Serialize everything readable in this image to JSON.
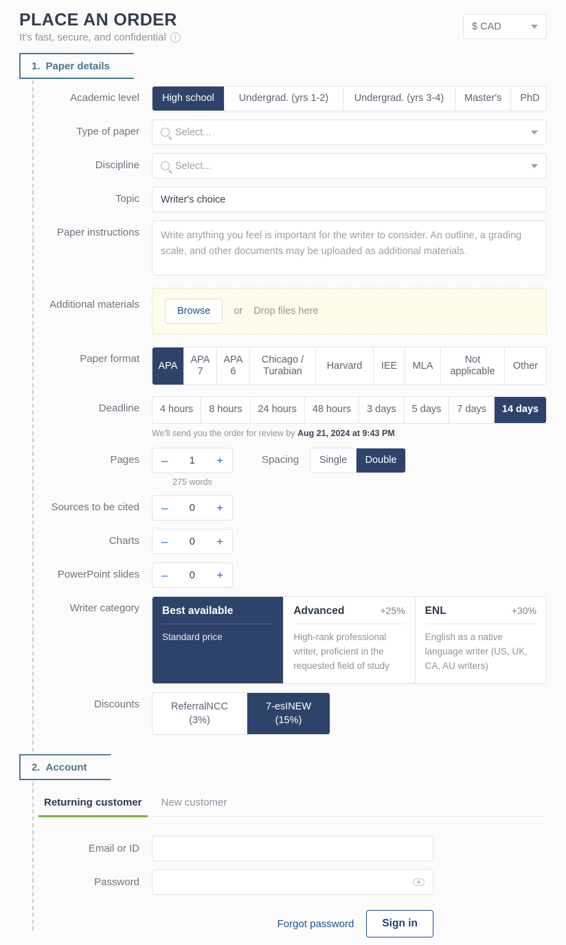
{
  "header": {
    "title": "PLACE AN ORDER",
    "subtitle": "It's fast, secure, and confidential",
    "info_icon": "info-icon",
    "currency": {
      "value": "$ CAD",
      "caret": "chevron-down-icon"
    }
  },
  "steps": {
    "step1": {
      "number": "1.",
      "label": "Paper details"
    },
    "step2": {
      "number": "2.",
      "label": "Account"
    }
  },
  "labels": {
    "academic_level": "Academic level",
    "type_of_paper": "Type of paper",
    "discipline": "Discipline",
    "topic": "Topic",
    "paper_instructions": "Paper instructions",
    "additional_materials": "Additional materials",
    "paper_format": "Paper format",
    "deadline": "Deadline",
    "pages": "Pages",
    "spacing": "Spacing",
    "sources": "Sources to be cited",
    "charts": "Charts",
    "slides": "PowerPoint slides",
    "writer_category": "Writer category",
    "discounts": "Discounts"
  },
  "academic_level": {
    "options": [
      {
        "label": "High school",
        "selected": true
      },
      {
        "label": "Undergrad. (yrs 1-2)",
        "selected": false
      },
      {
        "label": "Undergrad. (yrs 3-4)",
        "selected": false
      },
      {
        "label": "Master's",
        "selected": false
      },
      {
        "label": "PhD",
        "selected": false
      }
    ]
  },
  "type_of_paper": {
    "placeholder": "Select...",
    "value": "",
    "icon": "search-icon"
  },
  "discipline": {
    "placeholder": "Select...",
    "value": "",
    "icon": "search-icon"
  },
  "topic": {
    "value": "Writer's choice",
    "placeholder": ""
  },
  "paper_instructions": {
    "placeholder": "Write anything you feel is important for the writer to consider. An outline, a grading scale, and other documents may be uploaded as additional materials.",
    "value": ""
  },
  "additional_materials": {
    "browse_label": "Browse",
    "or_label": "or",
    "drop_label": "Drop files here"
  },
  "paper_format": {
    "options": [
      {
        "label": "APA",
        "selected": true
      },
      {
        "label": "APA 7",
        "selected": false
      },
      {
        "label": "APA 6",
        "selected": false
      },
      {
        "label": "Chicago / Turabian",
        "selected": false
      },
      {
        "label": "Harvard",
        "selected": false
      },
      {
        "label": "IEE",
        "selected": false
      },
      {
        "label": "MLA",
        "selected": false
      },
      {
        "label": "Not applicable",
        "selected": false
      },
      {
        "label": "Other",
        "selected": false
      }
    ]
  },
  "deadline": {
    "options": [
      {
        "label": "4 hours",
        "selected": false
      },
      {
        "label": "8 hours",
        "selected": false
      },
      {
        "label": "24 hours",
        "selected": false
      },
      {
        "label": "48 hours",
        "selected": false
      },
      {
        "label": "3 days",
        "selected": false
      },
      {
        "label": "5 days",
        "selected": false
      },
      {
        "label": "7 days",
        "selected": false
      },
      {
        "label": "14 days",
        "selected": true
      }
    ],
    "note_prefix": "We'll send you the order for review by ",
    "note_date": "Aug 21, 2024 at 9:43 PM",
    "note_suffix": "."
  },
  "pages": {
    "value": "1",
    "minus": "–",
    "plus": "+",
    "words": "275 words"
  },
  "spacing": {
    "options": [
      {
        "label": "Single",
        "selected": false
      },
      {
        "label": "Double",
        "selected": true
      }
    ]
  },
  "sources": {
    "value": "0",
    "minus": "–",
    "plus": "+"
  },
  "charts": {
    "value": "0",
    "minus": "–",
    "plus": "+"
  },
  "slides": {
    "value": "0",
    "minus": "–",
    "plus": "+"
  },
  "writer_category": {
    "cards": [
      {
        "title": "Best available",
        "pct": "",
        "desc": "Standard price",
        "selected": true
      },
      {
        "title": "Advanced",
        "pct": "+25%",
        "desc": "High-rank professional writer, proficient in the requested field of study",
        "selected": false
      },
      {
        "title": "ENL",
        "pct": "+30%",
        "desc": "English as a native language writer (US, UK, CA, AU writers)",
        "selected": false
      }
    ]
  },
  "discounts": {
    "options": [
      {
        "code": "ReferralNCC",
        "pct": "(3%)",
        "selected": false
      },
      {
        "code": "7-esINEW",
        "pct": "(15%)",
        "selected": true
      }
    ]
  },
  "account": {
    "tabs": [
      {
        "label": "Returning customer",
        "active": true
      },
      {
        "label": "New customer",
        "active": false
      }
    ],
    "email_label": "Email or ID",
    "email_value": "",
    "password_label": "Password",
    "password_value": "",
    "eye_icon": "eye-icon",
    "forgot_label": "Forgot password",
    "signin_label": "Sign in"
  },
  "colors": {
    "accent_navy": "#2e4369",
    "ribbon_teal": "#4b788c",
    "tab_green": "#7cb342",
    "link_blue": "#1f4f97",
    "dropzone_bg": "#fdfbe9"
  }
}
